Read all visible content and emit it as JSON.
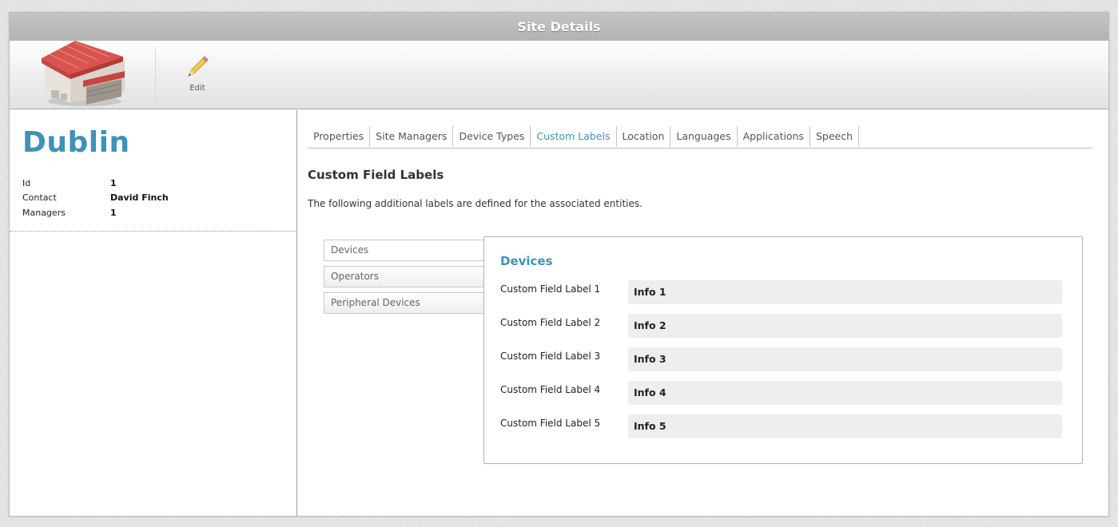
{
  "window": {
    "title": "Site Details"
  },
  "toolbar": {
    "logo_icon": "warehouse-icon",
    "edit_label": "Edit",
    "edit_icon": "pencil-icon"
  },
  "site": {
    "name": "Dublin",
    "details": [
      {
        "key": "Id",
        "value": "1"
      },
      {
        "key": "Contact",
        "value": "David Finch"
      },
      {
        "key": "Managers",
        "value": "1"
      }
    ]
  },
  "tabs": [
    {
      "label": "Properties"
    },
    {
      "label": "Site Managers"
    },
    {
      "label": "Device Types"
    },
    {
      "label": "Custom Labels"
    },
    {
      "label": "Location"
    },
    {
      "label": "Languages"
    },
    {
      "label": "Applications"
    },
    {
      "label": "Speech"
    }
  ],
  "active_tab": "Custom Labels",
  "section": {
    "title": "Custom Field Labels",
    "description": "The following additional labels are defined for the associated entities."
  },
  "entities": [
    {
      "label": "Devices"
    },
    {
      "label": "Operators"
    },
    {
      "label": "Peripheral Devices"
    }
  ],
  "selected_entity": "Devices",
  "detail": {
    "title": "Devices",
    "fields": [
      {
        "label": "Custom Field Label 1",
        "value": "Info 1"
      },
      {
        "label": "Custom Field Label 2",
        "value": "Info 2"
      },
      {
        "label": "Custom Field Label 3",
        "value": "Info 3"
      },
      {
        "label": "Custom Field Label 4",
        "value": "Info 4"
      },
      {
        "label": "Custom Field Label 5",
        "value": "Info 5"
      }
    ]
  },
  "colors": {
    "accent": "#3e92b8",
    "titlebar": "#b9b9b9",
    "field_bg": "#eeeeee"
  }
}
